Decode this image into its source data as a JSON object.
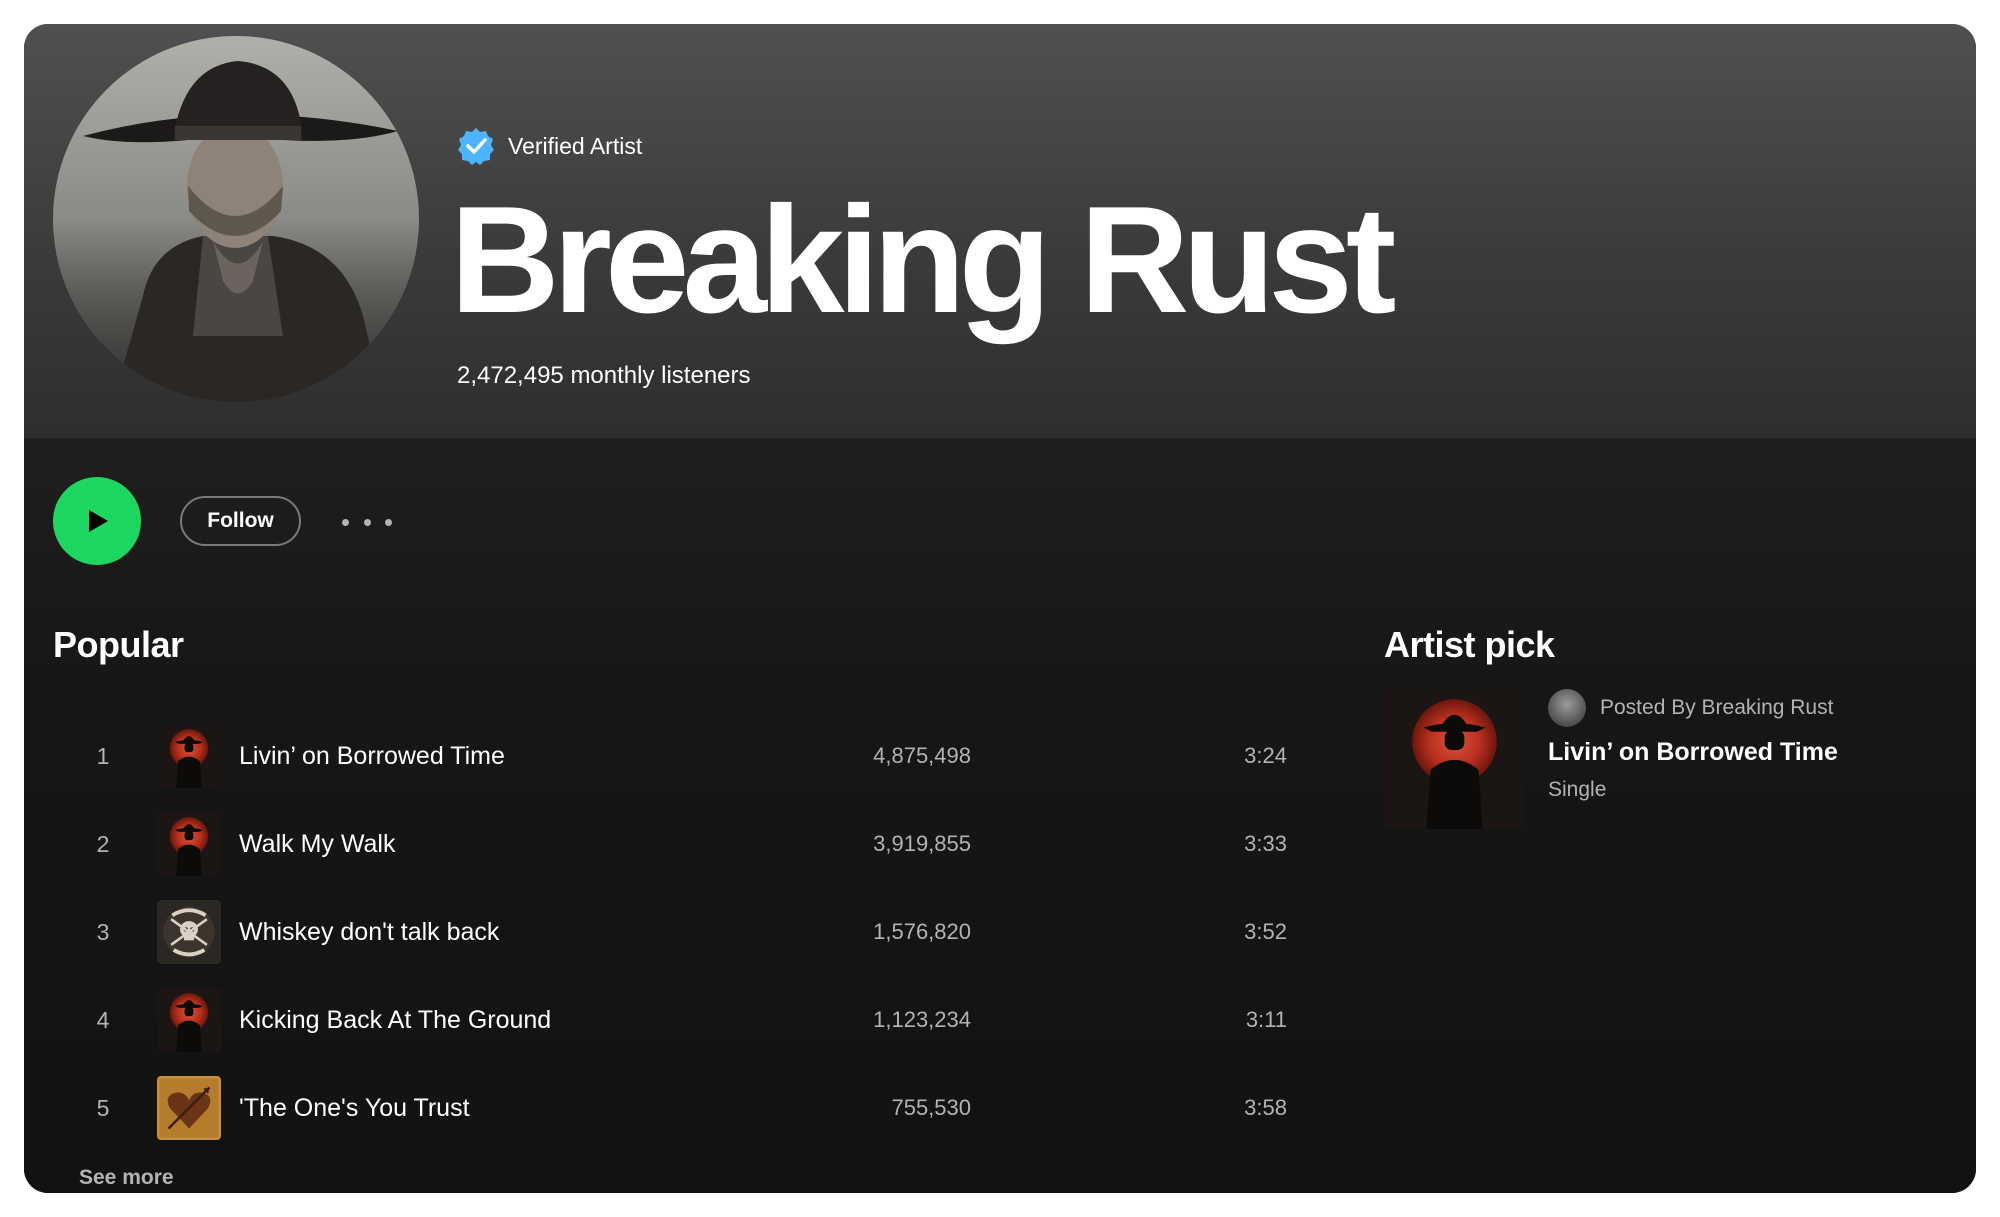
{
  "artist": {
    "verified_label": "Verified Artist",
    "name": "Breaking Rust",
    "monthly_listeners": "2,472,495 monthly listeners"
  },
  "actions": {
    "play_icon": "play-icon",
    "follow_label": "Follow",
    "more_icon": "more-options-icon"
  },
  "popular": {
    "title": "Popular",
    "tracks": [
      {
        "number": "1",
        "title": "Livin’ on Borrowed Time",
        "plays": "4,875,498",
        "duration": "3:24",
        "art": "red-moon-cowboy"
      },
      {
        "number": "2",
        "title": "Walk My Walk",
        "plays": "3,919,855",
        "duration": "3:33",
        "art": "red-moon-cowboy"
      },
      {
        "number": "3",
        "title": "Whiskey don't talk back",
        "plays": "1,576,820",
        "duration": "3:52",
        "art": "country-outlaw-skull"
      },
      {
        "number": "4",
        "title": "Kicking Back At The Ground",
        "plays": "1,123,234",
        "duration": "3:11",
        "art": "red-moon-cowboy"
      },
      {
        "number": "5",
        "title": "'The One's You Trust",
        "plays": "755,530",
        "duration": "3:58",
        "art": "heart-arrow"
      }
    ],
    "see_more_label": "See more"
  },
  "artist_pick": {
    "title": "Artist pick",
    "posted_by": "Posted By Breaking Rust",
    "item_title": "Livin’ on Borrowed Time",
    "item_type": "Single"
  },
  "colors": {
    "accent_green": "#1ed760",
    "verified_blue": "#4cb3ff",
    "background": "#121212",
    "muted_text": "#b3b3b3"
  }
}
